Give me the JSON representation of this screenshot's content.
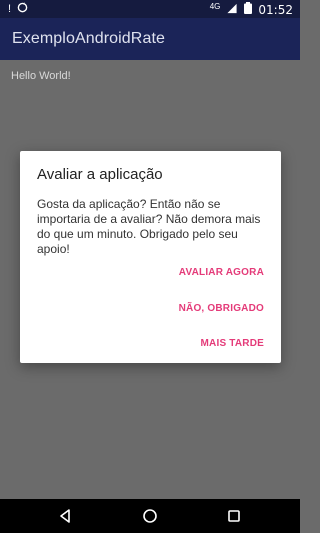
{
  "status_bar": {
    "network": "4G",
    "time": "01:52"
  },
  "app": {
    "title": "ExemploAndroidRate"
  },
  "content": {
    "hello": "Hello World!"
  },
  "dialog": {
    "title": "Avaliar a aplicação",
    "message": "Gosta da aplicação? Então não se importaria de a avaliar? Não demora mais do que um minuto. Obrigado pelo seu apoio!",
    "rate_now": "AVALIAR AGORA",
    "no_thanks": "NÃO, OBRIGADO",
    "later": "MAIS TARDE"
  },
  "colors": {
    "accent": "#e43b79",
    "app_bar": "#1b2458",
    "status_bar": "#151b3f",
    "scrim": "#6b6b6b"
  },
  "icons": [
    "notification-icon",
    "sync-icon",
    "signal-icon",
    "battery-icon",
    "back-icon",
    "home-icon",
    "recent-apps-icon"
  ]
}
